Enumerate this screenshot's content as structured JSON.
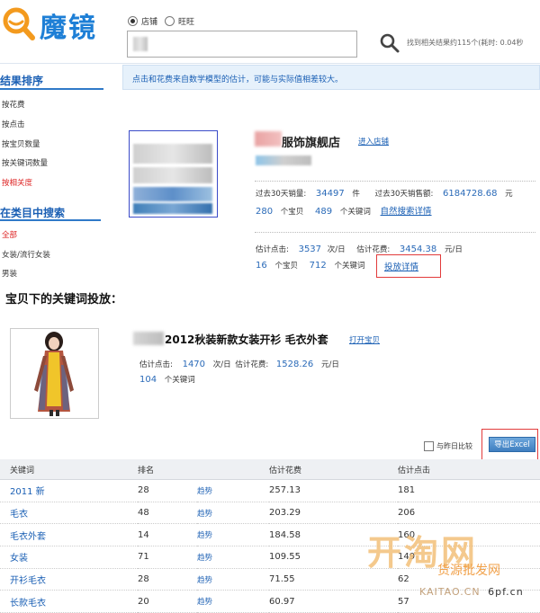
{
  "header": {
    "logo_text": "魔镜",
    "radios": [
      {
        "label": "店铺",
        "checked": true
      },
      {
        "label": "旺旺",
        "checked": false
      }
    ],
    "result_count": "找到相关结果约115个(耗时: 0.04秒"
  },
  "notice": "点击和花费来自数学模型的估计，可能与实际值相差较大。",
  "sidebar": {
    "sort_title": "结果排序",
    "sort_items": [
      {
        "label": "按花费",
        "active": false
      },
      {
        "label": "按点击",
        "active": false
      },
      {
        "label": "按宝贝数量",
        "active": false
      },
      {
        "label": "按关键词数量",
        "active": false
      },
      {
        "label": "按相关度",
        "active": true
      }
    ],
    "category_title": "在类目中搜索",
    "category_items": [
      {
        "label": "全部",
        "active": true
      },
      {
        "label": "女装/流行女装",
        "active": false
      },
      {
        "label": "男装",
        "active": false
      }
    ]
  },
  "shop": {
    "name": "服饰旗舰店",
    "enter_link": "进入店铺",
    "sales_30d_label": "过去30天销量:",
    "sales_30d_value": "34497",
    "sales_30d_unit": "件",
    "amount_30d_label": "过去30天销售额:",
    "amount_30d_value": "6184728.68",
    "amount_30d_unit": "元",
    "items_count": "280",
    "items_label": "个宝贝",
    "keywords_count": "489",
    "keywords_label": "个关键词",
    "natural_search_link": "自然搜索详情",
    "est_clicks_label": "估计点击:",
    "est_clicks_value": "3537",
    "est_clicks_unit": "次/日",
    "est_cost_label": "估计花费:",
    "est_cost_value": "3454.38",
    "est_cost_unit": "元/日",
    "ad_items_count": "16",
    "ad_items_label": "个宝贝",
    "ad_keywords_count": "712",
    "ad_keywords_label": "个关键词",
    "ad_detail_link": "投放详情"
  },
  "section_title": "宝贝下的关键词投放：",
  "product": {
    "title": "2012秋装新款女装开衫 毛衣外套",
    "open_link": "打开宝贝",
    "est_clicks_label": "估计点击:",
    "est_clicks_value": "1470",
    "est_clicks_unit": "次/日",
    "est_cost_label": "估计花费:",
    "est_cost_value": "1528.26",
    "est_cost_unit": "元/日",
    "keywords_count": "104",
    "keywords_label": "个关键词"
  },
  "compare_label": "与昨日比较",
  "export_label": "导出Excel",
  "table": {
    "headers": [
      "关键词",
      "排名",
      "",
      "估计花费",
      "估计点击"
    ],
    "rows": [
      {
        "keyword": "2011 新",
        "rank": "28",
        "trend": "趋势",
        "cost": "257.13",
        "clicks": "181"
      },
      {
        "keyword": "毛衣",
        "rank": "48",
        "trend": "趋势",
        "cost": "203.29",
        "clicks": "206"
      },
      {
        "keyword": "毛衣外套",
        "rank": "14",
        "trend": "趋势",
        "cost": "184.58",
        "clicks": "160"
      },
      {
        "keyword": "女装",
        "rank": "71",
        "trend": "趋势",
        "cost": "109.55",
        "clicks": "149"
      },
      {
        "keyword": "开衫毛衣",
        "rank": "28",
        "trend": "趋势",
        "cost": "71.55",
        "clicks": "62"
      },
      {
        "keyword": "长款毛衣",
        "rank": "20",
        "trend": "趋势",
        "cost": "60.97",
        "clicks": "57"
      }
    ]
  },
  "watermark": {
    "main": "开淘网",
    "sub": "货源批发网",
    "url": "KAITAO.CN",
    "extra": "6pf.cn"
  },
  "colors": {
    "brand_blue": "#1e7fd6",
    "link_blue": "#1a5fb4",
    "highlight_red": "#e23b3b"
  }
}
